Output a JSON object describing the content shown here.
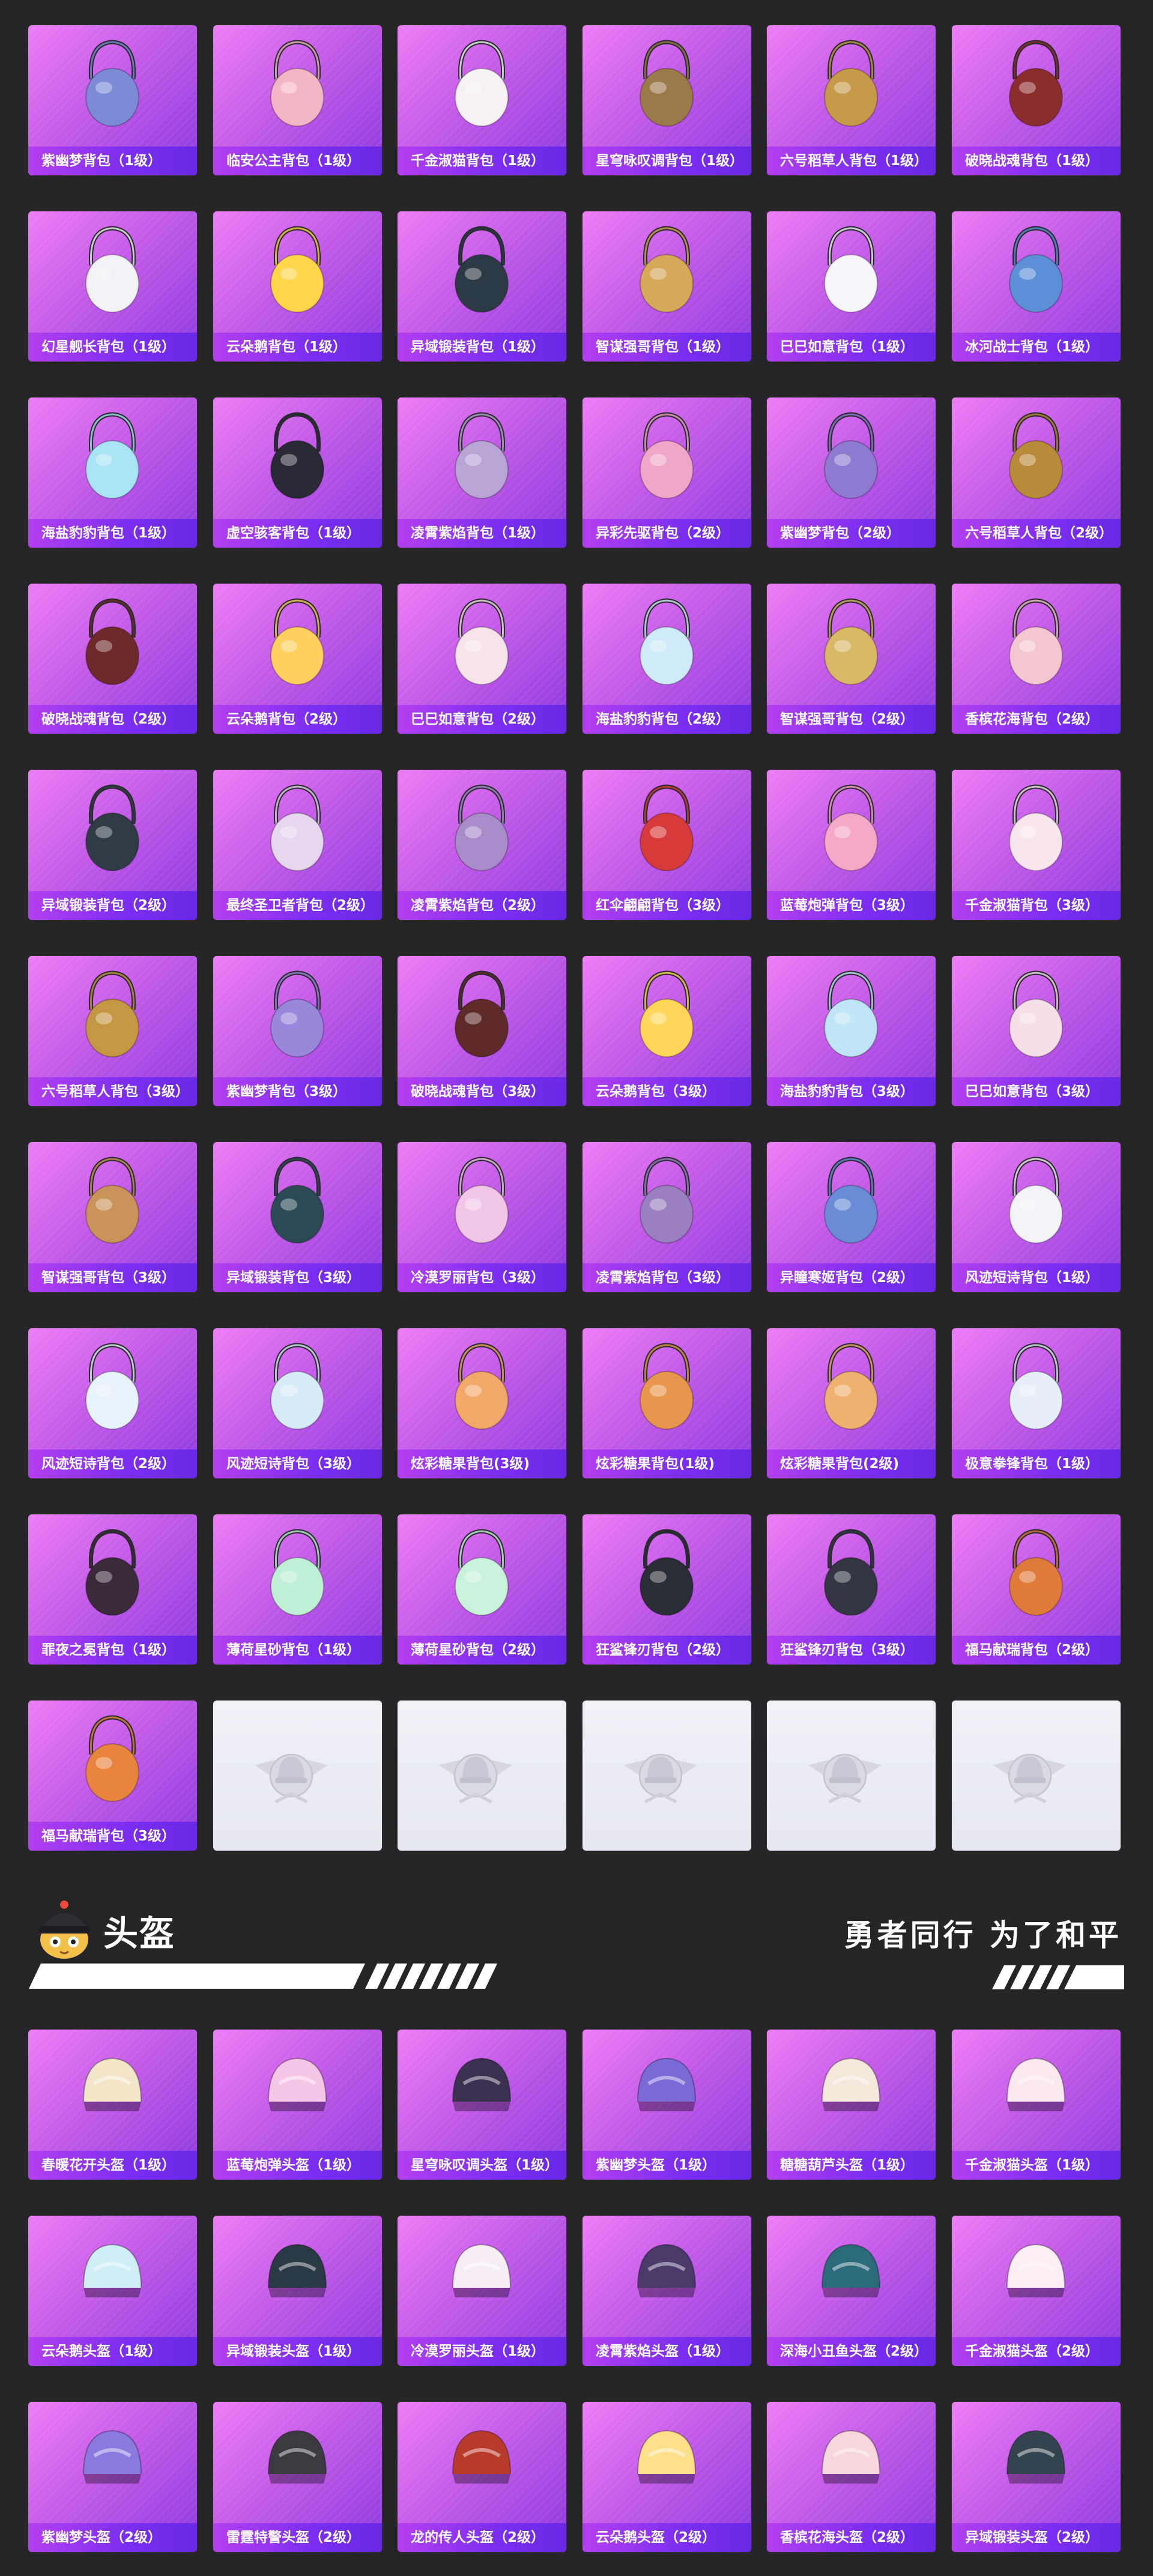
{
  "backpacks": [
    {
      "name": "紫幽梦背包（1级）",
      "icon": "bunny-bag-icon",
      "accent": "#7c8bd6"
    },
    {
      "name": "临安公主背包（1级）",
      "icon": "flower-bag-icon",
      "accent": "#f4b6c6"
    },
    {
      "name": "千金淑猫背包（1级）",
      "icon": "cat-bag-icon",
      "accent": "#f5f1f4"
    },
    {
      "name": "星穹咏叹调背包（1级）",
      "icon": "lantern-bag-icon",
      "accent": "#9b7a4a"
    },
    {
      "name": "六号稻草人背包（1级）",
      "icon": "scarecrow-bag-icon",
      "accent": "#c79a4a"
    },
    {
      "name": "破晓战魂背包（1级）",
      "icon": "armor-bag-icon",
      "accent": "#8c2d2d"
    },
    {
      "name": "幻星舰长背包（1级）",
      "icon": "eyeball-bag-icon",
      "accent": "#f2f2f6"
    },
    {
      "name": "云朵鹅背包（1级）",
      "icon": "cloud-bag-icon",
      "accent": "#ffd54a"
    },
    {
      "name": "异域锻装背包（1级）",
      "icon": "tech-bag-icon",
      "accent": "#2b3a44"
    },
    {
      "name": "智谋强哥背包（1级）",
      "icon": "bear-bag-icon",
      "accent": "#d5a85a"
    },
    {
      "name": "巳巳如意背包（1级）",
      "icon": "snake-bag-icon",
      "accent": "#f5f5fa"
    },
    {
      "name": "冰河战士背包（1级）",
      "icon": "warrior-bag-icon",
      "accent": "#5c8fd6"
    },
    {
      "name": "海盐豹豹背包（1级）",
      "icon": "seal-bag-icon",
      "accent": "#a8e4f4"
    },
    {
      "name": "虚空骇客背包（1级）",
      "icon": "hacker-bag-icon",
      "accent": "#2a2a36"
    },
    {
      "name": "凌霄紫焰背包（1级）",
      "icon": "flame-bag-icon",
      "accent": "#b9a4d6"
    },
    {
      "name": "异彩先驱背包（2级）",
      "icon": "pioneer-bag-icon",
      "accent": "#f0a6c8"
    },
    {
      "name": "紫幽梦背包（2级）",
      "icon": "bunny-bag-icon",
      "accent": "#8e7ad0"
    },
    {
      "name": "六号稻草人背包（2级）",
      "icon": "scarecrow-bag-icon",
      "accent": "#b88a3a"
    },
    {
      "name": "破晓战魂背包（2级）",
      "icon": "armor-bag-icon",
      "accent": "#6e2a2a"
    },
    {
      "name": "云朵鹅背包（2级）",
      "icon": "cloud-bag-icon",
      "accent": "#ffd060"
    },
    {
      "name": "巳巳如意背包（2级）",
      "icon": "snake-bag-icon",
      "accent": "#f7e4ea"
    },
    {
      "name": "海盐豹豹背包（2级）",
      "icon": "seal-bag-icon",
      "accent": "#cfeaf8"
    },
    {
      "name": "智谋强哥背包（2级）",
      "icon": "bear-bag-icon",
      "accent": "#d9b866"
    },
    {
      "name": "香槟花海背包（2级）",
      "icon": "rose-bag-icon",
      "accent": "#f4c6d2"
    },
    {
      "name": "异域锻装背包（2级）",
      "icon": "tech-bag-icon",
      "accent": "#2f3c46"
    },
    {
      "name": "最终圣卫者背包（2级）",
      "icon": "wing-bag-icon",
      "accent": "#e6d6ee"
    },
    {
      "name": "凌霄紫焰背包（2级）",
      "icon": "flame-bag-icon",
      "accent": "#a88cc9"
    },
    {
      "name": "红伞翩翩背包（3级）",
      "icon": "umbrella-bag-icon",
      "accent": "#d63a3a"
    },
    {
      "name": "蓝莓炮弹背包（3级）",
      "icon": "cake-bag-icon",
      "accent": "#f7a8c8"
    },
    {
      "name": "千金淑猫背包（3级）",
      "icon": "cat-bag-icon",
      "accent": "#f7e6ee"
    },
    {
      "name": "六号稻草人背包（3级）",
      "icon": "scarecrow-bag-icon",
      "accent": "#c59742"
    },
    {
      "name": "紫幽梦背包（3级）",
      "icon": "bunny-bag-icon",
      "accent": "#9a86db"
    },
    {
      "name": "破晓战魂背包（3级）",
      "icon": "armor-bag-icon",
      "accent": "#5e2a2a"
    },
    {
      "name": "云朵鹅背包（3级）",
      "icon": "cloud-bag-icon",
      "accent": "#ffd65a"
    },
    {
      "name": "海盐豹豹背包（3级）",
      "icon": "seal-bag-icon",
      "accent": "#bfe6f6"
    },
    {
      "name": "巳巳如意背包（3级）",
      "icon": "snake-bag-icon",
      "accent": "#f6dfe8"
    },
    {
      "name": "智谋强哥背包（3级）",
      "icon": "bear-bag-icon",
      "accent": "#c9945a"
    },
    {
      "name": "异域锻装背包（3级）",
      "icon": "tech-bag-icon",
      "accent": "#2c4a56"
    },
    {
      "name": "冷漠罗丽背包（3级）",
      "icon": "heart-bag-icon",
      "accent": "#f1c6e6"
    },
    {
      "name": "凌霄紫焰背包（3级）",
      "icon": "flame-bag-icon",
      "accent": "#9a80c0"
    },
    {
      "name": "异瞳寒姬背包（2级）",
      "icon": "doll-bag-icon",
      "accent": "#6a8cd6"
    },
    {
      "name": "风迹短诗背包（1级）",
      "icon": "box-bag-icon",
      "accent": "#f4f4f8"
    },
    {
      "name": "风迹短诗背包（2级）",
      "icon": "box-bag-icon",
      "accent": "#e8f2fa"
    },
    {
      "name": "风迹短诗背包（3级）",
      "icon": "box-bag-icon",
      "accent": "#d8ecf8"
    },
    {
      "name": "炫彩糖果背包(3级)",
      "icon": "donut-bag-icon",
      "accent": "#f3a86a"
    },
    {
      "name": "炫彩糖果背包(1级)",
      "icon": "donut-bag-icon",
      "accent": "#e8964e"
    },
    {
      "name": "炫彩糖果背包(2级)",
      "icon": "donut-bag-icon",
      "accent": "#f0b070"
    },
    {
      "name": "极意拳锋背包（1级）",
      "icon": "cup-bag-icon",
      "accent": "#e6eef8"
    },
    {
      "name": "罪夜之冕背包（1级）",
      "icon": "bat-bag-icon",
      "accent": "#3a2a3a"
    },
    {
      "name": "薄荷星砂背包（1级）",
      "icon": "mint-bag-icon",
      "accent": "#bff0d6"
    },
    {
      "name": "薄荷星砂背包（2级）",
      "icon": "mint-bag-icon",
      "accent": "#c9f2dc"
    },
    {
      "name": "狂鲨锋刃背包（2级）",
      "icon": "shark-bag-icon",
      "accent": "#2a2d36"
    },
    {
      "name": "狂鲨锋刃背包（3级）",
      "icon": "shark-bag-icon",
      "accent": "#333642"
    },
    {
      "name": "福马献瑞背包（2级）",
      "icon": "horse-bag-icon",
      "accent": "#e07a3a"
    },
    {
      "name": "福马献瑞背包（3级）",
      "icon": "horse-bag-icon",
      "accent": "#e8843e"
    }
  ],
  "empty_slots": [
    {
      "icon": "emblem-placeholder-icon"
    },
    {
      "icon": "emblem-placeholder-icon"
    },
    {
      "icon": "emblem-placeholder-icon"
    },
    {
      "icon": "emblem-placeholder-icon"
    },
    {
      "icon": "emblem-placeholder-icon"
    }
  ],
  "helmet_section": {
    "title": "头盔",
    "slogan": "勇者同行 为了和平",
    "mascot_icon": "helmet-mascot-icon"
  },
  "helmets": [
    {
      "name": "春暖花开头盔（1级）",
      "icon": "helmet-icon",
      "accent": "#f3e6c8"
    },
    {
      "name": "蓝莓炮弹头盔（1级）",
      "icon": "helmet-icon",
      "accent": "#f6c6e6"
    },
    {
      "name": "星穹咏叹调头盔（1级）",
      "icon": "helmet-icon",
      "accent": "#3a3050"
    },
    {
      "name": "紫幽梦头盔（1级）",
      "icon": "helmet-icon",
      "accent": "#7a6ad6"
    },
    {
      "name": "糖糖葫芦头盔（1级）",
      "icon": "helmet-icon",
      "accent": "#f4e8dc"
    },
    {
      "name": "千金淑猫头盔（1级）",
      "icon": "helmet-icon",
      "accent": "#fae8f0"
    },
    {
      "name": "云朵鹅头盔（1级）",
      "icon": "helmet-icon",
      "accent": "#cfeef6"
    },
    {
      "name": "异域锻装头盔（1级）",
      "icon": "helmet-icon",
      "accent": "#2a3a44"
    },
    {
      "name": "冷漠罗丽头盔（1级）",
      "icon": "helmet-icon",
      "accent": "#f6eef4"
    },
    {
      "name": "凌霄紫焰头盔（1级）",
      "icon": "helmet-icon",
      "accent": "#4a3a6a"
    },
    {
      "name": "深海小丑鱼头盔（2级）",
      "icon": "helmet-icon",
      "accent": "#2a6a7a"
    },
    {
      "name": "千金淑猫头盔（2级）",
      "icon": "helmet-icon",
      "accent": "#fbeef4"
    },
    {
      "name": "紫幽梦头盔（2级）",
      "icon": "helmet-icon",
      "accent": "#8a7ae0"
    },
    {
      "name": "雷霆特警头盔（2级）",
      "icon": "helmet-icon",
      "accent": "#3a3a40"
    },
    {
      "name": "龙的传人头盔（2级）",
      "icon": "helmet-icon",
      "accent": "#b83a2a"
    },
    {
      "name": "云朵鹅头盔（2级）",
      "icon": "helmet-icon",
      "accent": "#ffe08a"
    },
    {
      "name": "香槟花海头盔（2级）",
      "icon": "helmet-icon",
      "accent": "#f7d6de"
    },
    {
      "name": "异域锻装头盔（2级）",
      "icon": "helmet-icon",
      "accent": "#34444e"
    }
  ]
}
